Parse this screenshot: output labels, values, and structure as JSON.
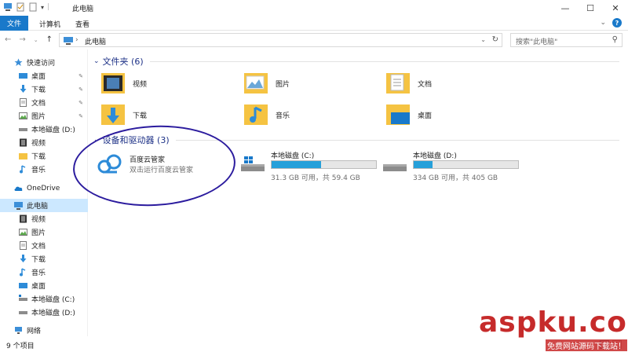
{
  "window": {
    "title": "此电脑",
    "minimize": "—",
    "maximize": "☐",
    "close": "✕"
  },
  "ribbon": {
    "tabs": [
      "文件",
      "计算机",
      "查看"
    ]
  },
  "address": {
    "path": "此电脑",
    "separator": "›",
    "search_placeholder": "搜索\"此电脑\""
  },
  "sidebar": {
    "quick_access": "快速访问",
    "quick_items": [
      "桌面",
      "下载",
      "文档",
      "图片",
      "本地磁盘 (D:)",
      "视频",
      "下载",
      "音乐"
    ],
    "onedrive": "OneDrive",
    "this_pc": "此电脑",
    "pc_items": [
      "视频",
      "图片",
      "文档",
      "下载",
      "音乐",
      "桌面",
      "本地磁盘 (C:)",
      "本地磁盘 (D:)"
    ],
    "network": "网络"
  },
  "content": {
    "folders_header": "文件夹 (6)",
    "folders": [
      "视频",
      "图片",
      "文档",
      "下载",
      "音乐",
      "桌面"
    ],
    "devices_header": "设备和驱动器 (3)",
    "app_name": "百度云管家",
    "app_desc": "双击运行百度云管家",
    "drives": [
      {
        "name": "本地磁盘 (C:)",
        "free": "31.3 GB 可用，共 59.4 GB",
        "used_fraction": 0.47
      },
      {
        "name": "本地磁盘 (D:)",
        "free": "334 GB 可用，共 405 GB",
        "used_fraction": 0.18
      }
    ]
  },
  "status": {
    "count": "9 个项目"
  },
  "watermark": {
    "text": "aspku.com",
    "sub": "免费网站源码下载站！"
  },
  "colors": {
    "accent": "#1979ca",
    "selection": "#cce8ff",
    "drive_bar": "#26a0da",
    "folder": "#f5c342",
    "annotation_circle": "#2b1b9e",
    "watermark": "#c62b2b"
  }
}
